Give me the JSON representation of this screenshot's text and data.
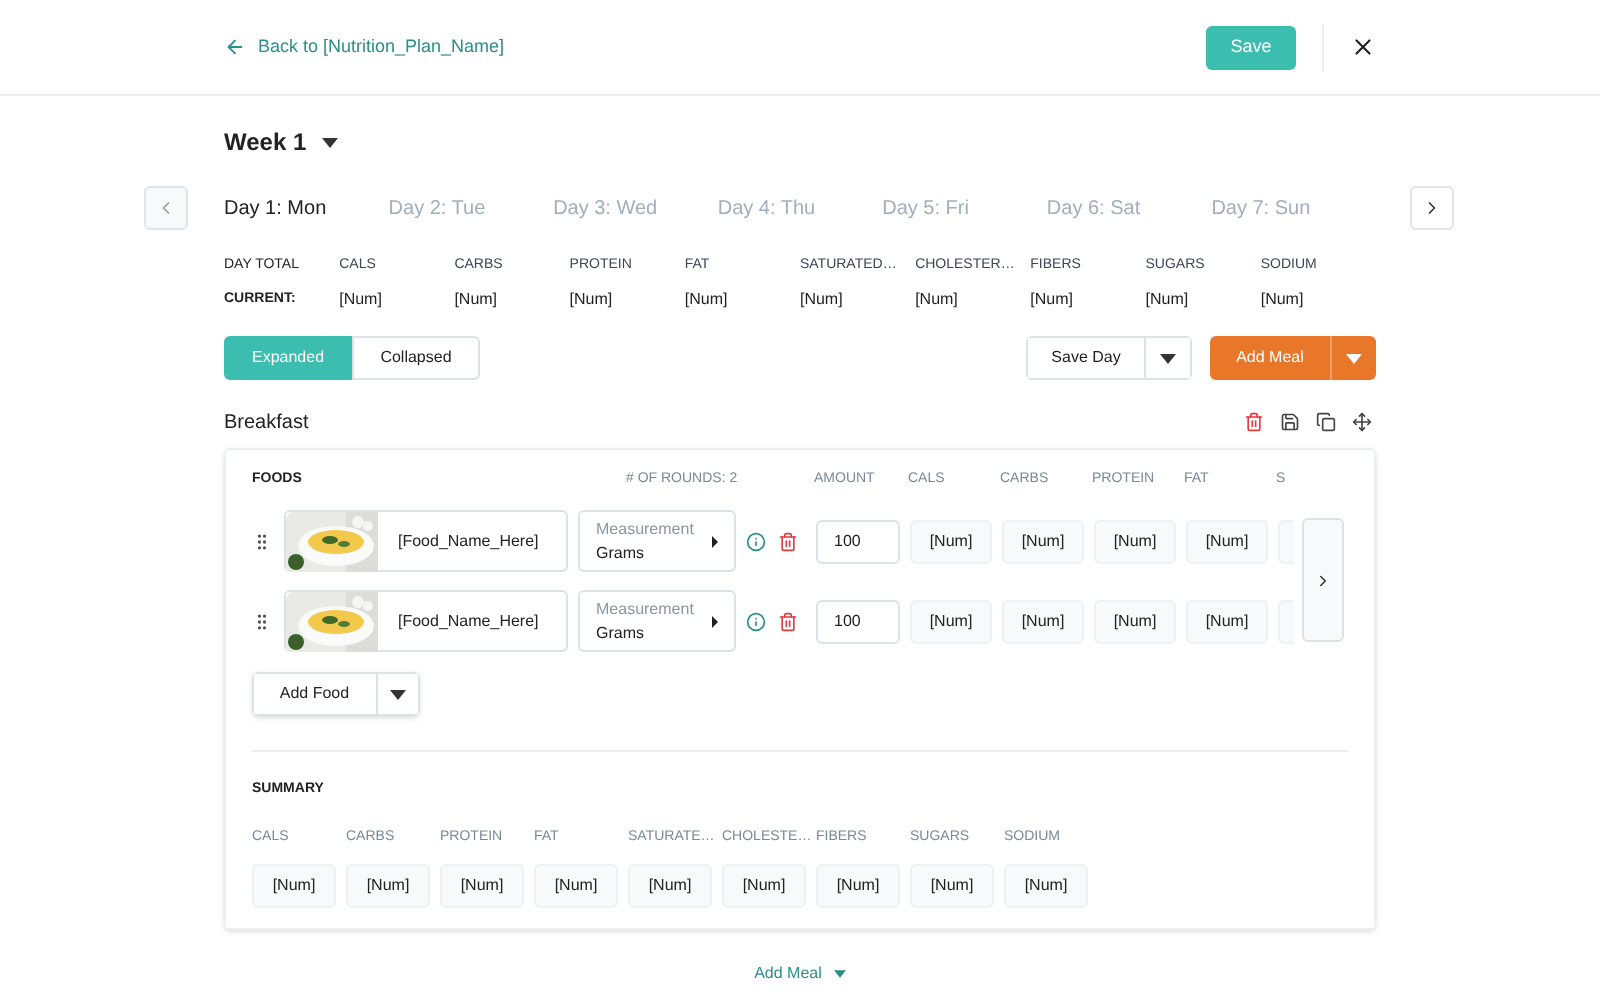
{
  "header": {
    "back_link": "Back to [Nutrition_Plan_Name]",
    "save_button": "Save"
  },
  "week": {
    "label": "Week 1"
  },
  "days": [
    {
      "label": "Day 1: Mon",
      "selected": true
    },
    {
      "label": "Day 2: Tue",
      "selected": false
    },
    {
      "label": "Day 3: Wed",
      "selected": false
    },
    {
      "label": "Day 4: Thu",
      "selected": false
    },
    {
      "label": "Day 5: Fri",
      "selected": false
    },
    {
      "label": "Day 6: Sat",
      "selected": false
    },
    {
      "label": "Day 7: Sun",
      "selected": false
    }
  ],
  "day_total": {
    "label": "DAY TOTAL",
    "current_label": "CURRENT:",
    "columns": [
      {
        "name": "CALS",
        "value": "[Num]"
      },
      {
        "name": "CARBS",
        "value": "[Num]"
      },
      {
        "name": "PROTEIN",
        "value": "[Num]"
      },
      {
        "name": "FAT",
        "value": "[Num]"
      },
      {
        "name": "SATURATED…",
        "value": "[Num]"
      },
      {
        "name": "CHOLESTER…",
        "value": "[Num]"
      },
      {
        "name": "FIBERS",
        "value": "[Num]"
      },
      {
        "name": "SUGARS",
        "value": "[Num]"
      },
      {
        "name": "SODIUM",
        "value": "[Num]"
      }
    ]
  },
  "view_toggle": [
    {
      "label": "Expanded",
      "selected": true
    },
    {
      "label": "Collapsed",
      "selected": false
    }
  ],
  "save_day_button": "Save Day",
  "add_meal_button": "Add Meal",
  "meals": [
    {
      "title": "Breakfast",
      "foods_header": "FOODS",
      "rounds": "# OF ROUNDS: 2",
      "nutrient_headers": [
        "AMOUNT",
        "CALS",
        "CARBS",
        "PROTEIN",
        "FAT",
        "S"
      ],
      "foods": [
        {
          "name": "[Food_Name_Here]",
          "measurement_label": "Measurement",
          "measurement_value": "Grams",
          "amount": "100",
          "values": [
            "[Num]",
            "[Num]",
            "[Num]",
            "[Num]"
          ]
        },
        {
          "name": "[Food_Name_Here]",
          "measurement_label": "Measurement",
          "measurement_value": "Grams",
          "amount": "100",
          "values": [
            "[Num]",
            "[Num]",
            "[Num]",
            "[Num]"
          ]
        }
      ],
      "add_food_button": "Add Food",
      "summary": {
        "title": "SUMMARY",
        "columns": [
          {
            "name": "CALS",
            "value": "[Num]"
          },
          {
            "name": "CARBS",
            "value": "[Num]"
          },
          {
            "name": "PROTEIN",
            "value": "[Num]"
          },
          {
            "name": "FAT",
            "value": "[Num]"
          },
          {
            "name": "SATURATE…",
            "value": "[Num]"
          },
          {
            "name": "CHOLESTE…",
            "value": "[Num]"
          },
          {
            "name": "FIBERS",
            "value": "[Num]"
          },
          {
            "name": "SUGARS",
            "value": "[Num]"
          },
          {
            "name": "SODIUM",
            "value": "[Num]"
          }
        ]
      }
    }
  ],
  "footer_add_meal": "Add Meal"
}
